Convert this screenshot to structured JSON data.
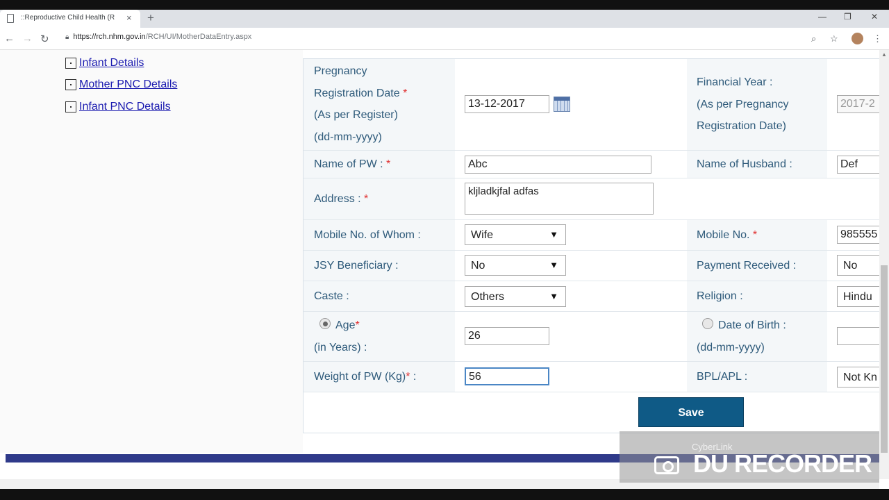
{
  "browser": {
    "tab_title": "::Reproductive Child Health (R",
    "tab_close": "×",
    "new_tab": "+",
    "win_min": "—",
    "win_max": "❐",
    "win_close": "✕",
    "url_host": "https://rch.nhm.gov.in",
    "url_path": "/RCH/UI/MotherDataEntry.aspx"
  },
  "sidebar": {
    "items": [
      {
        "label": "Infant Details"
      },
      {
        "label": "Mother PNC Details"
      },
      {
        "label": "Infant PNC Details"
      }
    ]
  },
  "form": {
    "reg_date_label": {
      "l1": "Pregnancy",
      "l2": "Registration Date",
      "l3": "(As per Register)",
      "l4": "(dd-mm-yyyy)"
    },
    "reg_date_value": "13-12-2017",
    "fin_year_label": {
      "l1": "Financial Year :",
      "l2": "(As per Pregnancy",
      "l3": "Registration Date)"
    },
    "fin_year_value": "2017-2",
    "name_pw_label": "Name of PW : ",
    "name_pw_value": "Abc",
    "husband_label": "Name of Husband :",
    "husband_value": "Def",
    "address_label": "Address : ",
    "address_value": "kljladkjfal adfas",
    "mobile_whom_label": "Mobile No. of Whom :",
    "mobile_whom_value": "Wife",
    "mobile_label": "Mobile No. ",
    "mobile_value": "985555",
    "jsy_label": "JSY Beneficiary :",
    "jsy_value": "No",
    "payment_label": "Payment Received :",
    "payment_value": "No",
    "caste_label": "Caste :",
    "caste_value": "Others",
    "religion_label": "Religion :",
    "religion_value": "Hindu",
    "age_label": "Age",
    "age_sub": "(in Years) :",
    "age_value": "26",
    "dob_label": "Date of Birth :",
    "dob_sub": "(dd-mm-yyyy)",
    "dob_value": "",
    "weight_label": "Weight of PW (Kg)",
    "weight_suffix": " :",
    "weight_value": "56",
    "bpl_label": "BPL/APL :",
    "bpl_value": "Not Kn",
    "required_mark": "*",
    "dropdown_arrow": "▼",
    "save_label": "Save"
  },
  "watermark": {
    "brand": "CyberLink",
    "title": "DU RECORDER"
  }
}
